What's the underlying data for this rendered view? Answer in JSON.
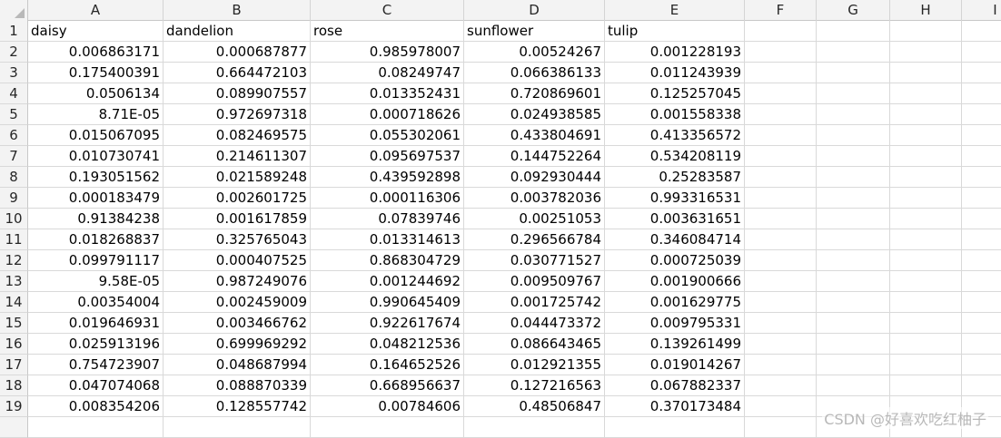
{
  "columns": [
    "A",
    "B",
    "C",
    "D",
    "E",
    "F",
    "G",
    "H",
    "I"
  ],
  "rows": [
    [
      "daisy",
      "dandelion",
      "rose",
      "sunflower",
      "tulip"
    ],
    [
      "0.006863171",
      "0.000687877",
      "0.985978007",
      "0.00524267",
      "0.001228193"
    ],
    [
      "0.175400391",
      "0.664472103",
      "0.08249747",
      "0.066386133",
      "0.011243939"
    ],
    [
      "0.0506134",
      "0.089907557",
      "0.013352431",
      "0.720869601",
      "0.125257045"
    ],
    [
      "8.71E-05",
      "0.972697318",
      "0.000718626",
      "0.024938585",
      "0.001558338"
    ],
    [
      "0.015067095",
      "0.082469575",
      "0.055302061",
      "0.433804691",
      "0.413356572"
    ],
    [
      "0.010730741",
      "0.214611307",
      "0.095697537",
      "0.144752264",
      "0.534208119"
    ],
    [
      "0.193051562",
      "0.021589248",
      "0.439592898",
      "0.092930444",
      "0.25283587"
    ],
    [
      "0.000183479",
      "0.002601725",
      "0.000116306",
      "0.003782036",
      "0.993316531"
    ],
    [
      "0.91384238",
      "0.001617859",
      "0.07839746",
      "0.00251053",
      "0.003631651"
    ],
    [
      "0.018268837",
      "0.325765043",
      "0.013314613",
      "0.296566784",
      "0.346084714"
    ],
    [
      "0.099791117",
      "0.000407525",
      "0.868304729",
      "0.030771527",
      "0.000725039"
    ],
    [
      "9.58E-05",
      "0.987249076",
      "0.001244692",
      "0.009509767",
      "0.001900666"
    ],
    [
      "0.00354004",
      "0.002459009",
      "0.990645409",
      "0.001725742",
      "0.001629775"
    ],
    [
      "0.019646931",
      "0.003466762",
      "0.922617674",
      "0.044473372",
      "0.009795331"
    ],
    [
      "0.025913196",
      "0.699969292",
      "0.048212536",
      "0.086643465",
      "0.139261499"
    ],
    [
      "0.754723907",
      "0.048687994",
      "0.164652526",
      "0.012921355",
      "0.019014267"
    ],
    [
      "0.047074068",
      "0.088870339",
      "0.668956637",
      "0.127216563",
      "0.067882337"
    ],
    [
      "0.008354206",
      "0.128557742",
      "0.00784606",
      "0.48506847",
      "0.370173484"
    ]
  ],
  "watermark": "CSDN @好喜欢吃红柚子"
}
